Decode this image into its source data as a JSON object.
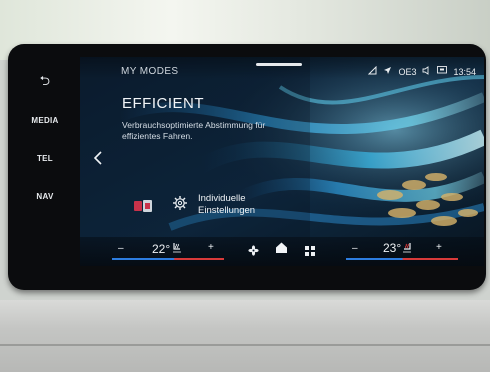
{
  "side_keys": {
    "back_icon": "back-arrow-icon",
    "back_glyph": "⮌",
    "media": "MEDIA",
    "tel": "TEL",
    "nav": "NAV"
  },
  "header": {
    "title": "MY MODES",
    "status": {
      "signal_icon": "phone-signal-icon",
      "location_icon": "location-arrow-icon",
      "network": "OE3",
      "volume_icon": "speaker-icon",
      "screen_icon": "display-icon",
      "time": "13:54"
    }
  },
  "mode": {
    "name": "EFFICIENT",
    "description": "Verbrauchsoptimierte Abstimmung für effizientes Fahren."
  },
  "settings": {
    "label": "Individuelle Einstellungen"
  },
  "climate": {
    "left": {
      "minus": "–",
      "temperature": "22°",
      "plus": "+"
    },
    "right": {
      "minus": "–",
      "temperature": "23°",
      "plus": "+"
    },
    "fan_icon": "fan-icon",
    "home_icon": "home-icon",
    "apps_icon": "grid-icon"
  },
  "colors": {
    "accent_blue": "#2d7de0",
    "accent_red": "#d83a3a",
    "screen_bg": "#0a1a2a"
  }
}
